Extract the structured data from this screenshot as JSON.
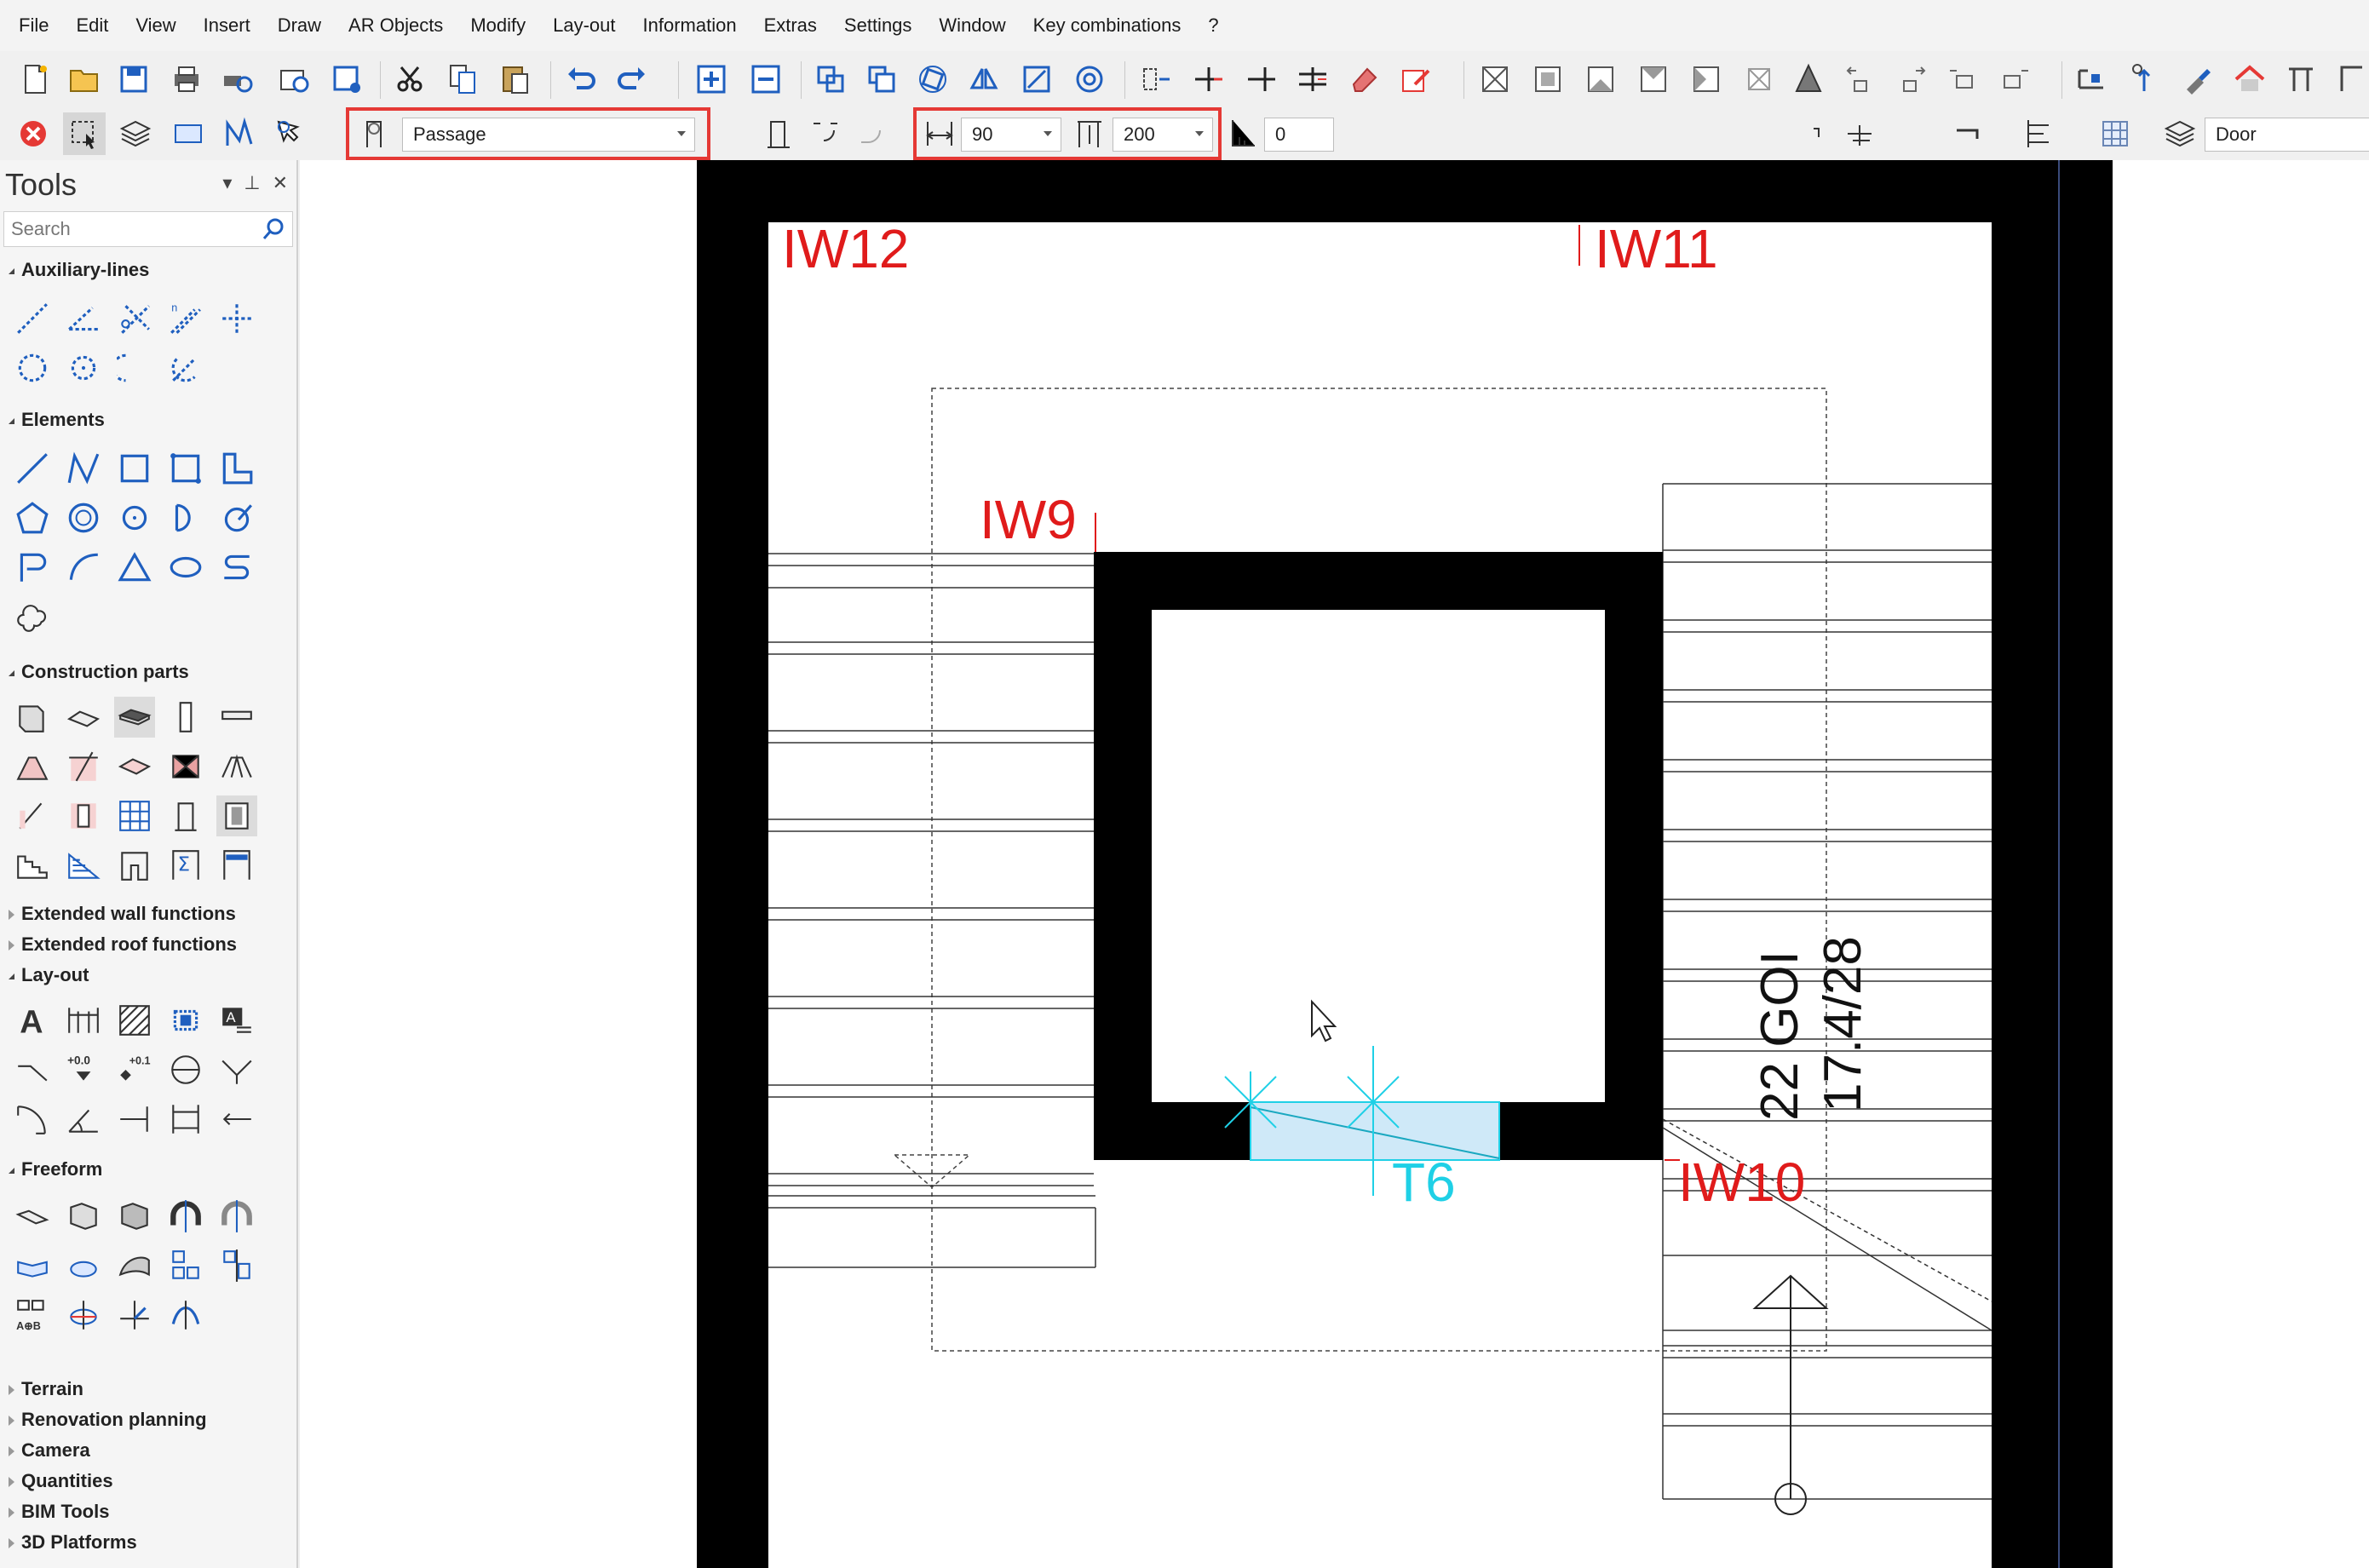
{
  "menu": [
    "File",
    "Edit",
    "View",
    "Insert",
    "Draw",
    "AR Objects",
    "Modify",
    "Lay-out",
    "Information",
    "Extras",
    "Settings",
    "Window",
    "Key combinations",
    "?"
  ],
  "toolbar2": {
    "type_value": "Passage",
    "width_value": "90",
    "height_value": "200",
    "parapet_value": "0",
    "layer_value": "Door"
  },
  "tools_panel": {
    "title": "Tools",
    "search_placeholder": "Search",
    "sections": {
      "aux": "Auxiliary-lines",
      "elements": "Elements",
      "construction": "Construction parts",
      "ext_wall": "Extended wall functions",
      "ext_roof": "Extended roof functions",
      "layout": "Lay-out",
      "freeform": "Freeform",
      "terrain": "Terrain",
      "renovation": "Renovation planning",
      "camera": "Camera",
      "quantities": "Quantities",
      "bim": "BIM Tools",
      "platforms": "3D Platforms"
    }
  },
  "drawing": {
    "labels": {
      "iw12": "IW12",
      "iw11": "IW11",
      "iw9": "IW9",
      "iw10": "IW10",
      "t6": "T6",
      "stair1": "22 GOI",
      "stair2": "17.4/28"
    },
    "colors": {
      "wall_label": "#e01b1b",
      "door": "#1fd0e6",
      "door_fill": "#cfe9f8"
    }
  },
  "icons": {
    "close": "close-icon",
    "select": "select-icon",
    "layers": "layers-icon",
    "rect": "rectangle-icon",
    "cut": "scissors-icon",
    "undo": "undo-icon",
    "redo": "redo-icon",
    "zoom_in": "zoom-in-icon",
    "zoom_out": "zoom-out-icon"
  }
}
